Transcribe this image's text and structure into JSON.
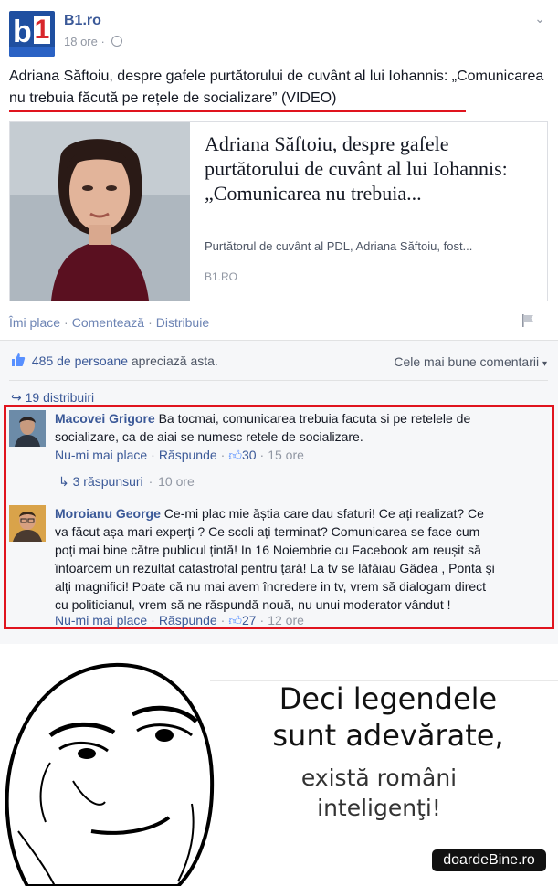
{
  "post": {
    "page_name": "B1.ro",
    "time": "18 ore",
    "privacy_icon": "globe-icon",
    "menu_icon": "chevron-down-icon",
    "text": "Adriana Săftoiu, despre gafele purtătorului de cuvânt al lui Iohannis: „Comunicarea nu trebuia făcută pe rețele de socializare” (VIDEO)"
  },
  "link_card": {
    "title": "Adriana Săftoiu, despre gafele purtătorului de cuvânt al lui Iohannis: „Comunicarea nu trebuia...",
    "description": "Purtătorul de cuvânt al PDL, Adriana Săftoiu, fost...",
    "domain": "B1.RO"
  },
  "actions": {
    "like": "Îmi place",
    "comment": "Comentează",
    "share": "Distribuie"
  },
  "stats": {
    "likes_count": "485 de persoane",
    "likes_suffix": "apreciază asta.",
    "sort": "Cele mai bune comentarii",
    "shares": "19 distribuiri"
  },
  "comments": [
    {
      "author": "Macovei Grigore",
      "text": "Ba tocmai, comunicarea trebuia facuta si pe retelele de socializare, ca de aiai se numesc retele de socializare.",
      "unlike": "Nu-mi mai place",
      "reply": "Răspunde",
      "likes": "30",
      "time": "15 ore",
      "replies_label": "3 răspunsuri",
      "replies_time": "10 ore"
    },
    {
      "author": "Moroianu George",
      "text": "Ce-mi plac mie ăștia care dau sfaturi! Ce ați realizat? Ce va făcut așa mari experți ? Ce scoli ați terminat? Comunicarea se face cum poți mai bine către publicul țintă! In 16 Noiembrie cu Facebook am reușit să întoarcem un rezultat catastrofal pentru țară! La tv se lăfăiau Gâdea , Ponta și alți magnifici! Poate că nu mai avem încredere in tv, vrem să dialogam direct cu politicianul, vrem să ne răspundă nouă, nu unui moderator vândut !",
      "unlike": "Nu-mi mai place",
      "reply": "Răspunde",
      "likes": "27",
      "time": "12 ore"
    }
  ],
  "meme": {
    "line1": "Deci legendele sunt adevărate,",
    "line2": "există români inteligenţi!",
    "watermark": "doardeBine.ro"
  },
  "colors": {
    "facebook_blue": "#3b5998",
    "highlight_red": "#e0141e",
    "b1_blue": "#1f4fa0"
  }
}
